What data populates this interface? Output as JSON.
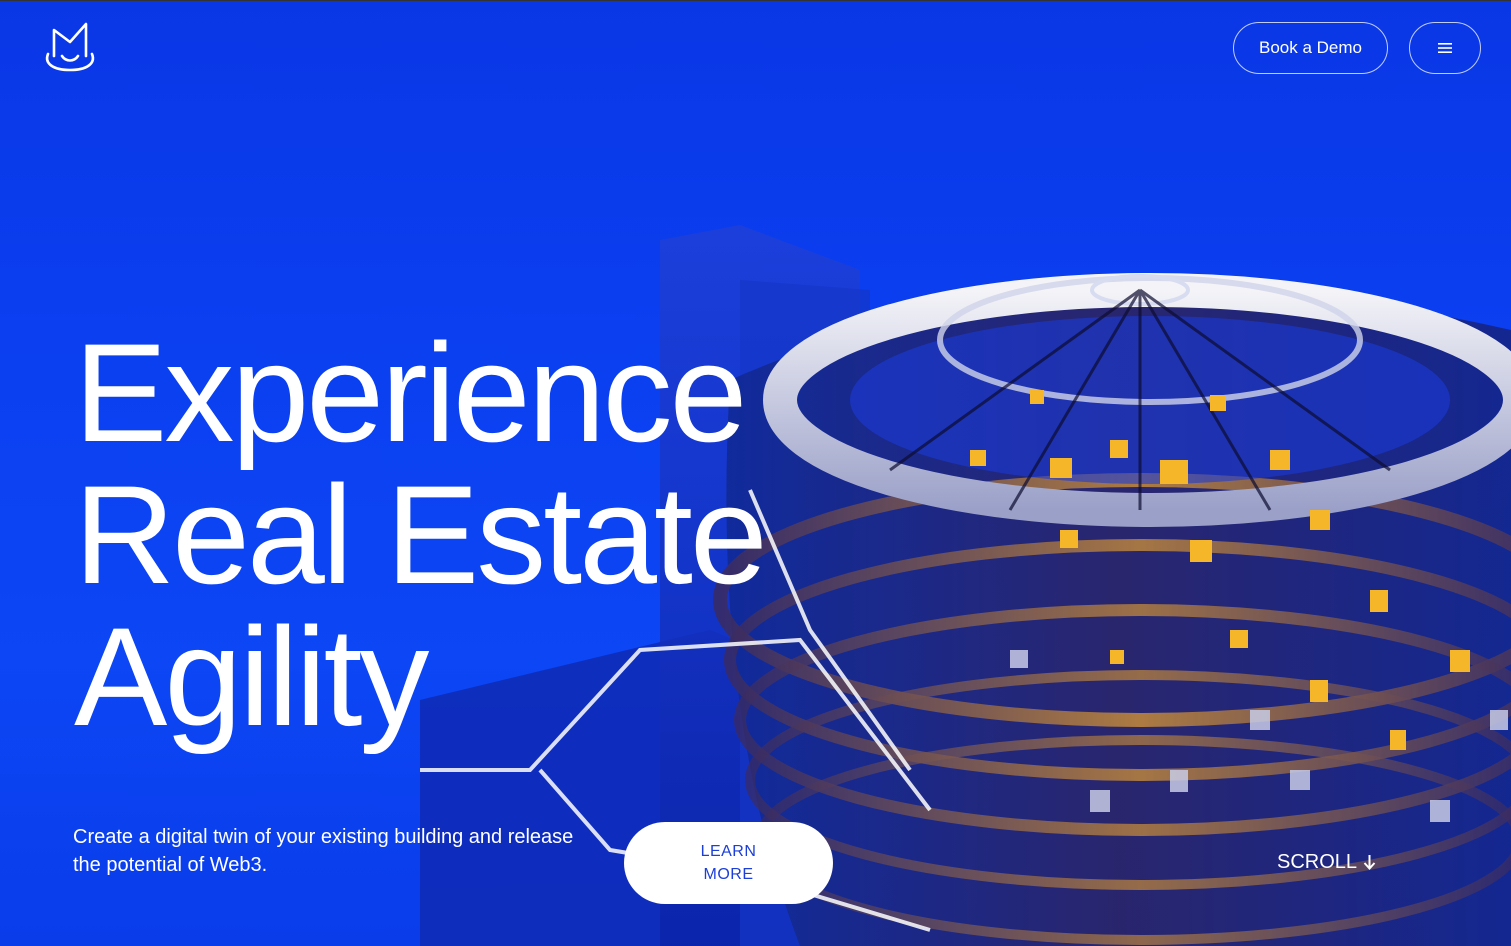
{
  "header": {
    "logo_name": "M cat logo",
    "book_demo_label": "Book a Demo",
    "menu_icon": "hamburger-menu-icon"
  },
  "hero": {
    "headline_line1": "Experience",
    "headline_line2": "Real Estate",
    "headline_line3": "Agility",
    "subtext": "Create a digital twin of your existing building and release the potential of Web3.",
    "cta_label": "LEARN MORE",
    "scroll_label": "SCROLL",
    "scroll_icon": "arrow-down-icon"
  },
  "colors": {
    "background": "#0b3ff0",
    "accent_gold": "#f5b62a",
    "cta_text": "#1c3fd8",
    "white": "#ffffff"
  }
}
